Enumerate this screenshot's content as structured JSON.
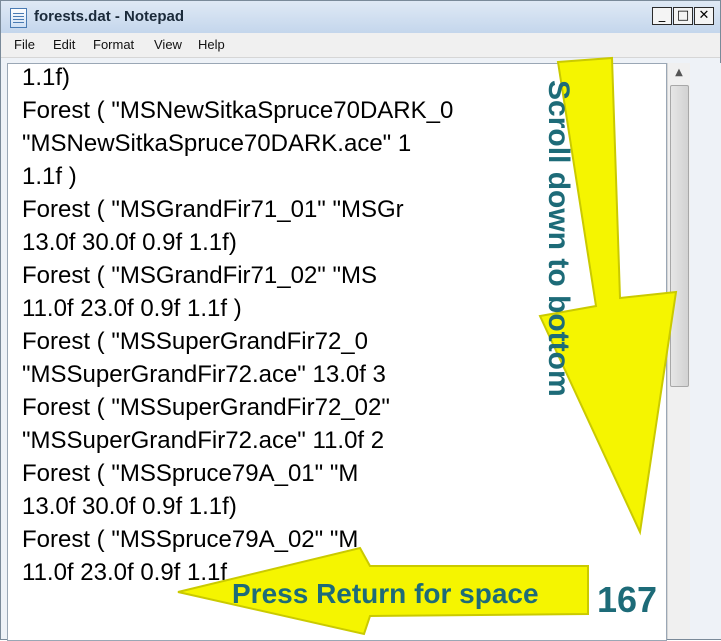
{
  "window": {
    "title": "forests.dat - Notepad",
    "controls": {
      "minimize": "_",
      "maximize": "□",
      "close": "✕"
    }
  },
  "menu": [
    "File",
    "Edit",
    "Format",
    "View",
    "Help"
  ],
  "editor": {
    "lines": [
      "1.1f)",
      "Forest ( \"MSNewSitkaSpruce70DARK_0",
      "\"MSNewSitkaSpruce70DARK.ace\"  1",
      "1.1f )",
      "Forest ( \"MSGrandFir71_01\"  \"MSGr",
      "13.0f 30.0f 0.9f 1.1f)",
      "Forest ( \"MSGrandFir71_02\"  \"MS",
      "11.0f 23.0f 0.9f 1.1f )",
      "Forest ( \"MSSuperGrandFir72_0",
      "\"MSSuperGrandFir72.ace\"  13.0f 3",
      "Forest ( \"MSSuperGrandFir72_02\"",
      "\"MSSuperGrandFir72.ace\"  11.0f 2",
      "Forest ( \"MSSpruce79A_01\"  \"M",
      "13.0f 30.0f 0.9f 1.1f)",
      "Forest ( \"MSSpruce79A_02\"  \"M",
      "11.0f 23.0f 0.9f 1.1f"
    ]
  },
  "annotations": {
    "scroll_hint": "Scroll down to bottom",
    "return_hint": "Press Return for space",
    "counter": "167",
    "arrow_color": "#f5f500",
    "text_color": "#1d6b78"
  },
  "icons": {
    "title_icon": "notepad-icon",
    "scroll_up": "▲"
  }
}
